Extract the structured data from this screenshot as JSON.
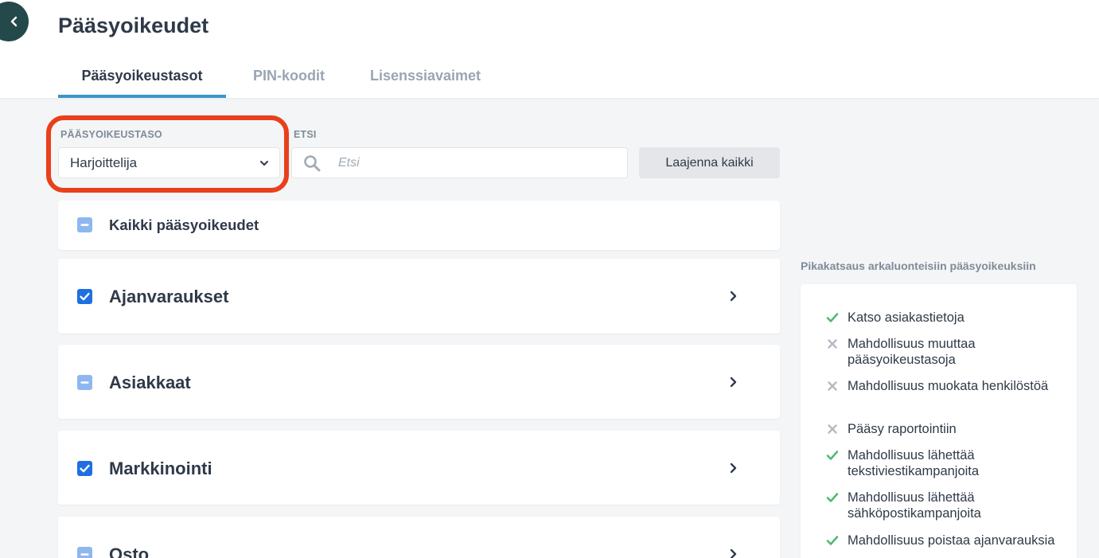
{
  "header": {
    "title": "Pääsyoikeudet",
    "tabs": [
      {
        "label": "Pääsyoikeustasot",
        "active": true
      },
      {
        "label": "PIN-koodit",
        "active": false
      },
      {
        "label": "Lisenssiavaimet",
        "active": false
      }
    ]
  },
  "filters": {
    "level_label": "PÄÄSYOIKEUSTASO",
    "level_value": "Harjoittelija",
    "search_label": "ETSI",
    "search_placeholder": "Etsi",
    "expand_all_label": "Laajenna kaikki"
  },
  "permissions": {
    "all_label": "Kaikki pääsyoikeudet",
    "all_state": "partial",
    "categories": [
      {
        "label": "Ajanvaraukset",
        "state": "checked"
      },
      {
        "label": "Asiakkaat",
        "state": "partial"
      },
      {
        "label": "Markkinointi",
        "state": "checked"
      },
      {
        "label": "Osto",
        "state": "partial"
      }
    ]
  },
  "sidebar": {
    "heading": "Pikakatsaus arkaluonteisiin pääsyoikeuksiin",
    "items": [
      {
        "text": "Katso asiakastietoja",
        "allowed": true
      },
      {
        "text": "Mahdollisuus muuttaa pääsyoikeustasoja",
        "allowed": false
      },
      {
        "text": "Mahdollisuus muokata henkilöstöä",
        "allowed": false
      },
      {
        "text": "Pääsy raportointiin",
        "allowed": false
      },
      {
        "text": "Mahdollisuus lähettää tekstiviestikampanjoita",
        "allowed": true
      },
      {
        "text": "Mahdollisuus lähettää sähköpostikampanjoita",
        "allowed": true
      },
      {
        "text": "Mahdollisuus poistaa ajanvarauksia",
        "allowed": true
      }
    ]
  },
  "colors": {
    "accent_tab": "#3b95c7",
    "checkbox_checked": "#1f6fe0",
    "checkbox_partial": "#8fb7ef",
    "check_green": "#4cba6e",
    "cross_gray": "#b3bac3",
    "highlight": "#e8401b",
    "back_button": "#23494a"
  },
  "icons": {
    "back": "chevron-left-icon",
    "dropdown": "chevron-down-icon",
    "search": "search-icon",
    "expand": "chevron-right-icon",
    "allowed": "check-icon",
    "denied": "cross-icon"
  }
}
